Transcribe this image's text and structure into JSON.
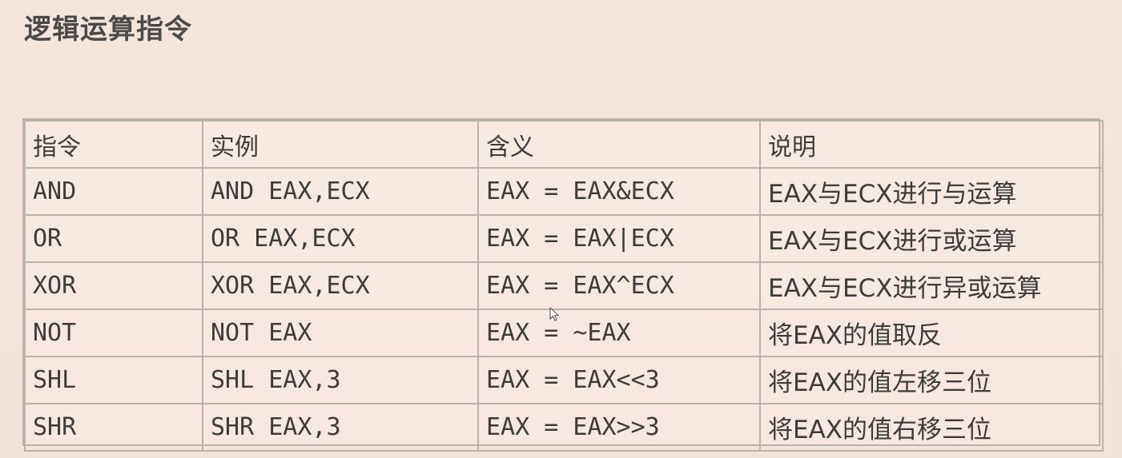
{
  "page": {
    "title": "逻辑运算指令"
  },
  "table": {
    "headers": [
      "指令",
      "实例",
      "含义",
      "说明"
    ],
    "rows": [
      [
        "AND",
        "AND EAX,ECX",
        "EAX = EAX&ECX",
        "EAX与ECX进行与运算"
      ],
      [
        "OR",
        "OR EAX,ECX",
        "EAX = EAX|ECX",
        "EAX与ECX进行或运算"
      ],
      [
        "XOR",
        "XOR EAX,ECX",
        "EAX = EAX^ECX",
        "EAX与ECX进行异或运算"
      ],
      [
        "NOT",
        "NOT EAX",
        "EAX = ~EAX",
        "将EAX的值取反"
      ],
      [
        "SHL",
        "SHL EAX,3",
        "EAX = EAX<<3",
        "将EAX的值左移三位"
      ],
      [
        "SHR",
        "SHR EAX,3",
        "EAX = EAX>>3",
        "将EAX的值右移三位"
      ]
    ]
  },
  "icons": {
    "cursor": "mouse-pointer-icon"
  },
  "colors": {
    "background": "#f3e4db",
    "border": "#b9b2ad",
    "text": "#3c3c3c"
  }
}
